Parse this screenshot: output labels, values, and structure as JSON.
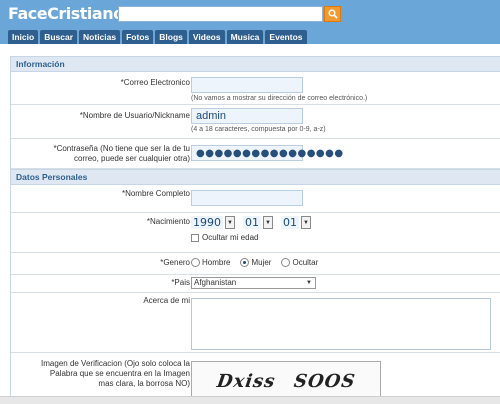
{
  "site": {
    "logo": "FaceCristianos"
  },
  "search": {
    "placeholder": ""
  },
  "nav": [
    "Inicio",
    "Buscar",
    "Noticias",
    "Fotos",
    "Blogs",
    "Videos",
    "Musica",
    "Eventos"
  ],
  "sections": {
    "info": "Información",
    "personal": "Datos Personales"
  },
  "form": {
    "email": {
      "label": "*Correo Electronico",
      "value": "",
      "help": "(No vamos a mostrar su dirección de correo electrónico.)"
    },
    "username": {
      "label": "*Nombre de Usuario/Nickname",
      "value": "admin",
      "help": "(4 a 18 caracteres, compuesta por 0-9, a-z)"
    },
    "password": {
      "label": "*Contraseña (No tiene que ser la de tu correo, puede ser cualquier otra)",
      "value": "●●●●●●●●●●●●●●●●"
    },
    "fullname": {
      "label": "*Nombre Completo",
      "value": ""
    },
    "birth": {
      "label": "*Nacimiento",
      "year": "1990",
      "month": "01",
      "day": "01",
      "hide_age": "Ocultar mi edad"
    },
    "gender": {
      "label": "*Genero",
      "options": [
        "Hombre",
        "Mujer",
        "Ocultar"
      ],
      "selected": "Mujer"
    },
    "country": {
      "label": "*Pais",
      "value": "Afghanistan"
    },
    "about": {
      "label": "Acerca de mi"
    },
    "captcha": {
      "label": "Imagen de Verificacion (Ojo solo coloca la Palabra que se encuentra en la Imagen mas clara, la borrosa NO)",
      "word1": "Dxiss",
      "word2": "SOOS"
    }
  }
}
